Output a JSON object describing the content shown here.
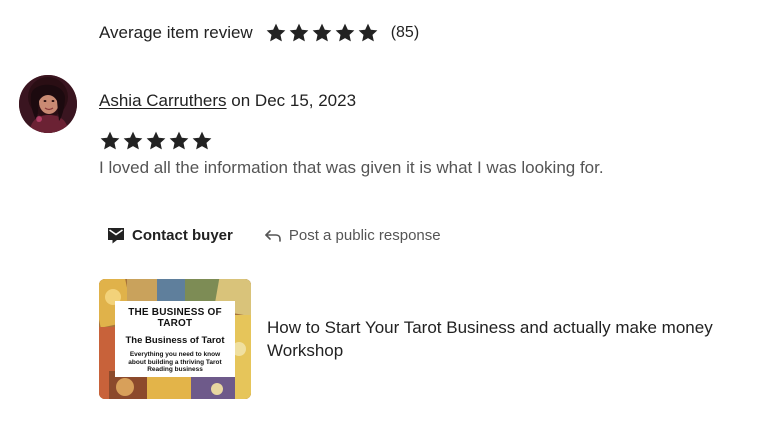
{
  "summary": {
    "label": "Average item review",
    "rating": 5,
    "count": "(85)"
  },
  "review": {
    "reviewer_name": "Ashia Carruthers",
    "date_text": " on Dec 15, 2023",
    "rating": 5,
    "text": "I loved all the information that was given it is what I was looking for."
  },
  "actions": {
    "contact_label": "Contact buyer",
    "contact_icon": "envelope-icon",
    "respond_label": "Post a public response",
    "respond_icon": "reply-arrow-icon"
  },
  "listing": {
    "title": "How to Start Your Tarot Business and actually make money Workshop",
    "thumbnail": {
      "heading": "THE BUSINESS OF TAROT",
      "subheading": "The Business of Tarot",
      "description": "Everything you need to know about building a thriving Tarot Reading business"
    }
  },
  "colors": {
    "text": "#222222",
    "muted": "#555555",
    "star": "#222222"
  }
}
